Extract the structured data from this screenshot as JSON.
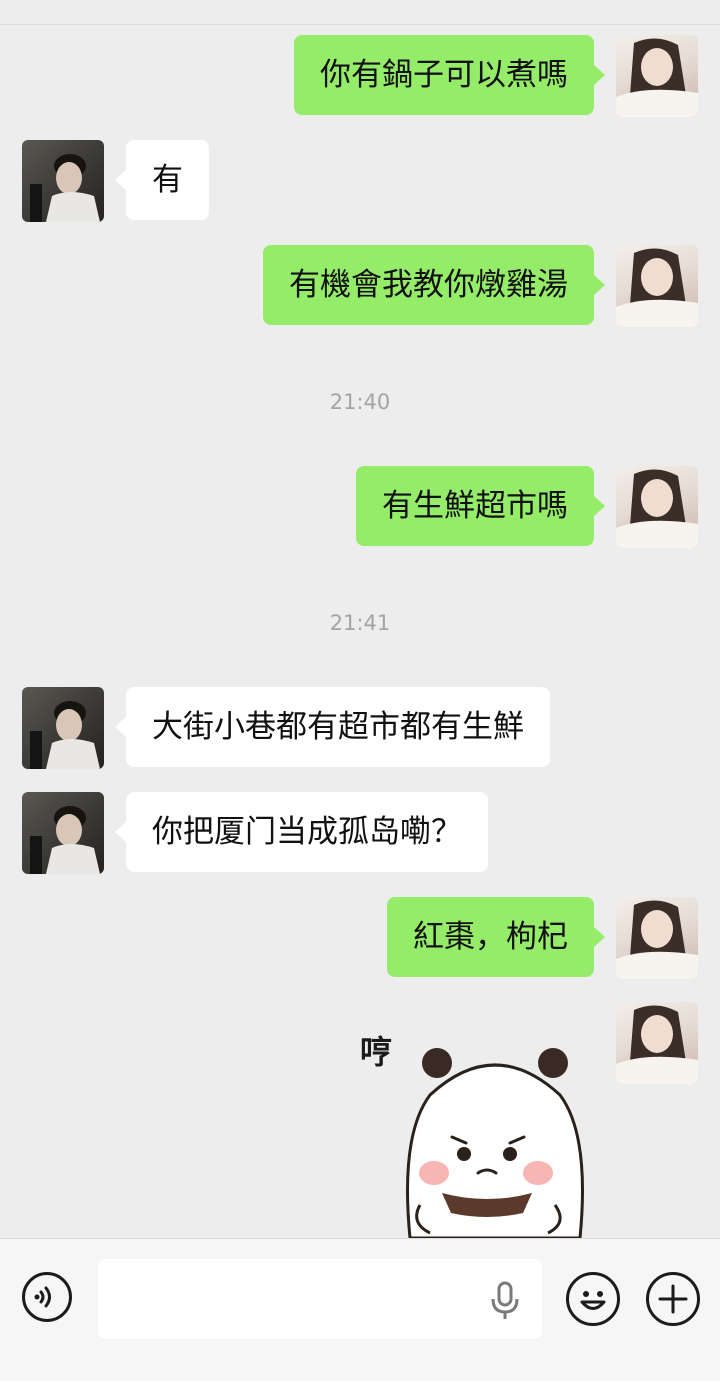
{
  "messages": [
    {
      "side": "me",
      "text": "你有鍋子可以煮嗎"
    },
    {
      "side": "other",
      "text": "有"
    },
    {
      "side": "me",
      "text": "有機會我教你燉雞湯"
    },
    {
      "side": "me",
      "text": "有生鮮超市嗎"
    },
    {
      "side": "other",
      "text": "大街小巷都有超市都有生鮮"
    },
    {
      "side": "other",
      "text": "你把厦门当成孤岛嘞？"
    },
    {
      "side": "me",
      "text": "紅棗，枸杞"
    }
  ],
  "timestamps": [
    "21:40",
    "21:41"
  ],
  "sticker": {
    "text": "哼",
    "icon": "panda-bear-sticker"
  },
  "input_bar": {
    "voice_icon": "voice-mode-icon",
    "mic_icon": "microphone-icon",
    "emoji_icon": "emoji-icon",
    "plus_icon": "plus-icon",
    "input_value": ""
  },
  "colors": {
    "background": "#ededed",
    "my_bubble": "#95ec69",
    "other_bubble": "#ffffff",
    "timestamp": "#a4a4a4"
  }
}
